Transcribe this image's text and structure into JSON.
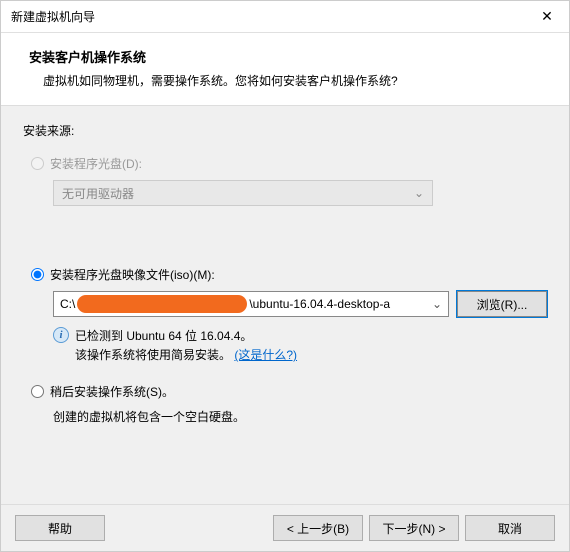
{
  "window": {
    "title": "新建虚拟机向导",
    "close": "✕"
  },
  "header": {
    "title": "安装客户机操作系统",
    "subtitle": "虚拟机如同物理机，需要操作系统。您将如何安装客户机操作系统?"
  },
  "source": {
    "label": "安装来源:",
    "disc": {
      "label": "安装程序光盘(D):",
      "dropdown": "无可用驱动器"
    },
    "iso": {
      "label": "安装程序光盘映像文件(iso)(M):",
      "path_prefix": "C:\\",
      "path_suffix": "\\ubuntu-16.04.4-desktop-a",
      "browse": "浏览(R)..."
    },
    "info": {
      "line1": "已检测到 Ubuntu 64 位 16.04.4。",
      "line2_prefix": "该操作系统将使用简易安装。",
      "link": "(这是什么?)"
    },
    "later": {
      "label": "稍后安装操作系统(S)。",
      "note": "创建的虚拟机将包含一个空白硬盘。"
    }
  },
  "footer": {
    "help": "帮助",
    "back": "< 上一步(B)",
    "next": "下一步(N) >",
    "cancel": "取消"
  }
}
